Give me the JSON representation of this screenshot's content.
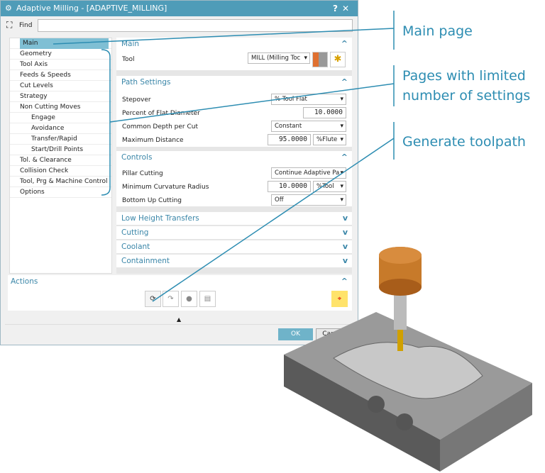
{
  "dialog": {
    "title": "Adaptive Milling - [ADAPTIVE_MILLING]",
    "help": "?",
    "close": "✕",
    "find_label": "Find",
    "find_value": ""
  },
  "tree": [
    "Main",
    "Geometry",
    "Tool Axis",
    "Feeds & Speeds",
    "Cut Levels",
    "Strategy",
    "Non Cutting Moves",
    "Engage",
    "Avoidance",
    "Transfer/Rapid",
    "Start/Drill Points",
    "Tol. & Clearance",
    "Collision Check",
    "Tool, Prg & Machine Control",
    "Options"
  ],
  "main": {
    "title": "Main",
    "tool_label": "Tool",
    "tool_value": "MILL (Milling Toc"
  },
  "path": {
    "title": "Path Settings",
    "stepover_label": "Stepover",
    "stepover_value": "% Tool Flat",
    "pct_label": "Percent of Flat Diameter",
    "pct_value": "10.0000",
    "depth_label": "Common Depth per Cut",
    "depth_value": "Constant",
    "maxd_label": "Maximum Distance",
    "maxd_value": "95.0000",
    "maxd_unit": "%Flute"
  },
  "controls": {
    "title": "Controls",
    "pillar_label": "Pillar Cutting",
    "pillar_value": "Continue Adaptive Pa",
    "mcr_label": "Minimum Curvature Radius",
    "mcr_value": "10.0000",
    "mcr_unit": "%Tool",
    "bottom_label": "Bottom Up Cutting",
    "bottom_value": "Off"
  },
  "collapsed": [
    "Low Height Transfers",
    "Cutting",
    "Coolant",
    "Containment"
  ],
  "actions": {
    "title": "Actions"
  },
  "footer": {
    "ok": "OK",
    "cancel": "Cancel"
  },
  "annotations": {
    "main_page": "Main page",
    "limited_1": "Pages with limited",
    "limited_2": "number of settings",
    "generate": "Generate toolpath"
  },
  "colors": {
    "title_bar": "#4f9cb8",
    "accent": "#2d8db2",
    "selection": "#7fbfd4",
    "ok": "#6fb3c9",
    "highlight": "#ffe36b"
  }
}
